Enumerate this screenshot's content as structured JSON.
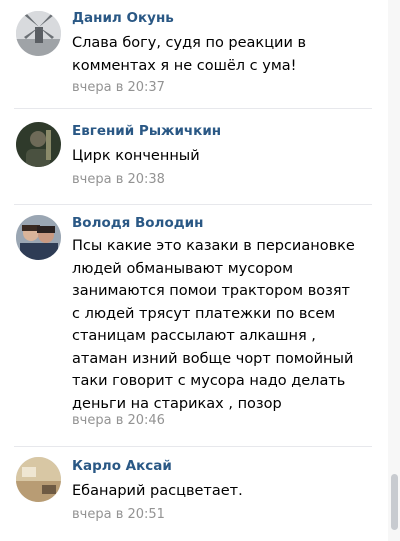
{
  "comments": [
    {
      "author": "Данил Окунь",
      "avatar": "windmill-avatar",
      "lines": [
        "Слава богу, судя по реакции в",
        "комментах я не сошёл с ума!"
      ],
      "time": "вчера в 20:37"
    },
    {
      "author": "Евгений Рыжичкин",
      "avatar": "dark-portrait-avatar",
      "lines": [
        "Цирк конченный"
      ],
      "time": "вчера в 20:38"
    },
    {
      "author": "Володя Володин",
      "avatar": "two-people-avatar",
      "lines": [
        "Псы какие это казаки в персиановке",
        "людей обманывают мусором",
        "занимаются помои трактором возят",
        "с людей трясут платежки по всем",
        "станицам рассылают алкашня ,",
        "атаман изний вобще чорт помойный",
        "таки говорит с мусора надо делать",
        "деньги на стариках , позор"
      ],
      "time": "вчера в 20:46"
    },
    {
      "author": "Карло Аксай",
      "avatar": "room-avatar",
      "lines": [
        "Ебанарий расцветает."
      ],
      "time": "вчера в 20:51"
    }
  ],
  "colors": {
    "author": "#2a5885",
    "time": "#939393",
    "text": "#000000",
    "divider": "#e7e8ec"
  }
}
